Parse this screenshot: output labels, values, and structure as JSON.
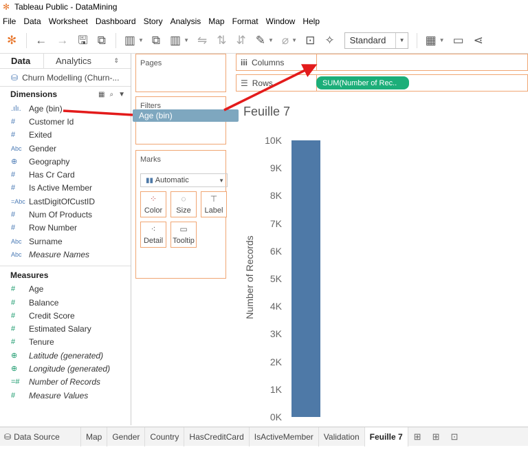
{
  "window": {
    "title": "Tableau Public - DataMining"
  },
  "menu": [
    "File",
    "Data",
    "Worksheet",
    "Dashboard",
    "Story",
    "Analysis",
    "Map",
    "Format",
    "Window",
    "Help"
  ],
  "toolbar": {
    "view_select": "Standard"
  },
  "data_pane": {
    "tab_data": "Data",
    "tab_analytics": "Analytics",
    "datasource": "Churn Modelling (Churn-...",
    "dimensions_label": "Dimensions",
    "dimensions": [
      {
        "type": ".ılı.",
        "name": "Age (bin)"
      },
      {
        "type": "#",
        "name": "Customer Id"
      },
      {
        "type": "#",
        "name": "Exited"
      },
      {
        "type": "Abc",
        "name": "Gender"
      },
      {
        "type": "⊕",
        "name": "Geography"
      },
      {
        "type": "#",
        "name": "Has Cr Card"
      },
      {
        "type": "#",
        "name": "Is Active Member"
      },
      {
        "type": "=Abc",
        "name": "LastDigitOfCustID"
      },
      {
        "type": "#",
        "name": "Num Of Products"
      },
      {
        "type": "#",
        "name": "Row Number"
      },
      {
        "type": "Abc",
        "name": "Surname"
      },
      {
        "type": "Abc",
        "name": "Measure Names"
      }
    ],
    "measures_label": "Measures",
    "measures": [
      {
        "type": "#",
        "name": "Age"
      },
      {
        "type": "#",
        "name": "Balance"
      },
      {
        "type": "#",
        "name": "Credit Score"
      },
      {
        "type": "#",
        "name": "Estimated Salary"
      },
      {
        "type": "#",
        "name": "Tenure"
      },
      {
        "type": "⊕",
        "name": "Latitude (generated)"
      },
      {
        "type": "⊕",
        "name": "Longitude (generated)"
      },
      {
        "type": "=#",
        "name": "Number of Records"
      },
      {
        "type": "#",
        "name": "Measure Values"
      }
    ]
  },
  "cards": {
    "pages": "Pages",
    "filters": "Filters",
    "filter_pill": "Age (bin)",
    "marks": "Marks",
    "mark_type": "Automatic",
    "color": "Color",
    "size": "Size",
    "label": "Label",
    "detail": "Detail",
    "tooltip": "Tooltip"
  },
  "shelves": {
    "columns": "Columns",
    "rows": "Rows",
    "rows_pill": "SUM(Number of Rec.."
  },
  "sheet": {
    "title": "Feuille 7"
  },
  "chart_data": {
    "type": "bar",
    "categories": [
      ""
    ],
    "values": [
      10000
    ],
    "ylabel": "Number of Records",
    "ylim": [
      0,
      10000
    ],
    "ticks": [
      "10K",
      "9K",
      "8K",
      "7K",
      "6K",
      "5K",
      "4K",
      "3K",
      "2K",
      "1K",
      "0K"
    ],
    "bar_color": "#4e79a7"
  },
  "bottom_tabs": [
    "Data Source",
    "Map",
    "Gender",
    "Country",
    "HasCreditCard",
    "IsActiveMember",
    "Validation",
    "Feuille 7"
  ],
  "active_tab": "Feuille 7"
}
